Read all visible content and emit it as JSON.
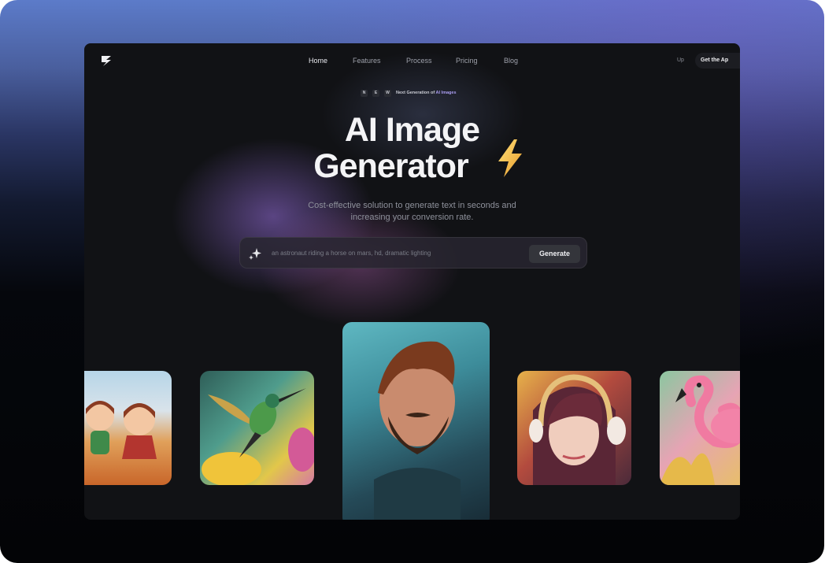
{
  "nav": {
    "items": [
      {
        "label": "Home",
        "active": true
      },
      {
        "label": "Features",
        "active": false
      },
      {
        "label": "Process",
        "active": false
      },
      {
        "label": "Pricing",
        "active": false
      },
      {
        "label": "Blog",
        "active": false
      }
    ],
    "signup_label": "Up",
    "get_app_label": "Get the Ap"
  },
  "badge": {
    "letters": [
      "N",
      "E",
      "W"
    ],
    "text_prefix": "Next Generation of",
    "text_highlight": "AI Images"
  },
  "hero": {
    "title_line1": "AI Image",
    "title_line2": "Generator",
    "subtitle_line1": "Cost-effective solution to generate text in seconds and",
    "subtitle_line2": "increasing your conversion rate."
  },
  "prompt": {
    "placeholder": "an astronaut riding a horse on mars, hd, dramatic lighting",
    "generate_label": "Generate"
  },
  "gallery": {
    "images": [
      "cartoon-girls",
      "hummingbird",
      "bearded-man",
      "girl-with-headphones",
      "flamingo"
    ]
  },
  "colors": {
    "accent": "#a99cf0",
    "bolt": "#f2c14a",
    "background": "#111215"
  }
}
